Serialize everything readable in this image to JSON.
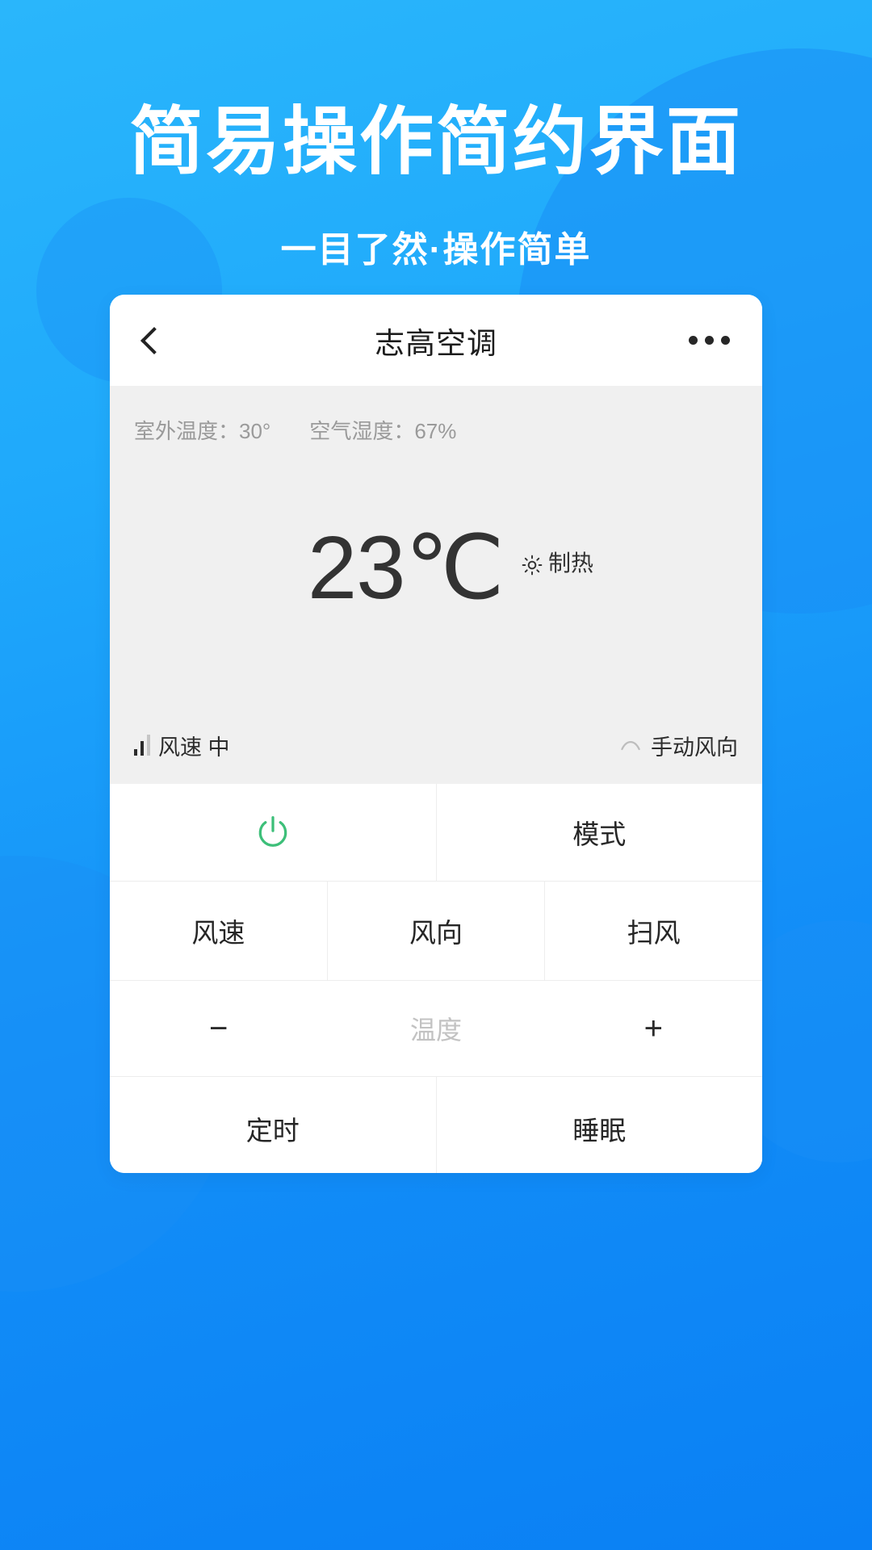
{
  "promo": {
    "headline": "简易操作简约界面",
    "subheadline": "一目了然·操作简单"
  },
  "colors": {
    "background_start": "#2ab6fb",
    "background_end": "#0a80f4",
    "blob": "#1a8ef6",
    "card": "#ffffff",
    "panel": "#f0f0f0",
    "power_accent": "#3dbf79",
    "text_primary": "#262626",
    "text_muted": "#9a9a9a"
  },
  "app": {
    "header": {
      "back_icon": "chevron-left-icon",
      "title": "志高空调",
      "more_icon": "more-horizontal-icon"
    },
    "display": {
      "outdoor_temp": "室外温度：30°",
      "humidity": "空气湿度：67%",
      "current_temp": "23℃",
      "mode_icon": "sun-icon",
      "mode_label": "制热",
      "fan_icon": "signal-bars-icon",
      "fan_label": "风速 中",
      "swing_icon": "swing-arc-icon",
      "swing_label": "手动风向"
    },
    "controls": {
      "power": {
        "icon": "power-icon",
        "label": ""
      },
      "mode": "模式",
      "fan_speed": "风速",
      "wind_direction": "风向",
      "swing": "扫风",
      "temp_minus": "−",
      "temp_label": "温度",
      "temp_plus": "+",
      "timer": "定时",
      "sleep": "睡眠"
    }
  }
}
